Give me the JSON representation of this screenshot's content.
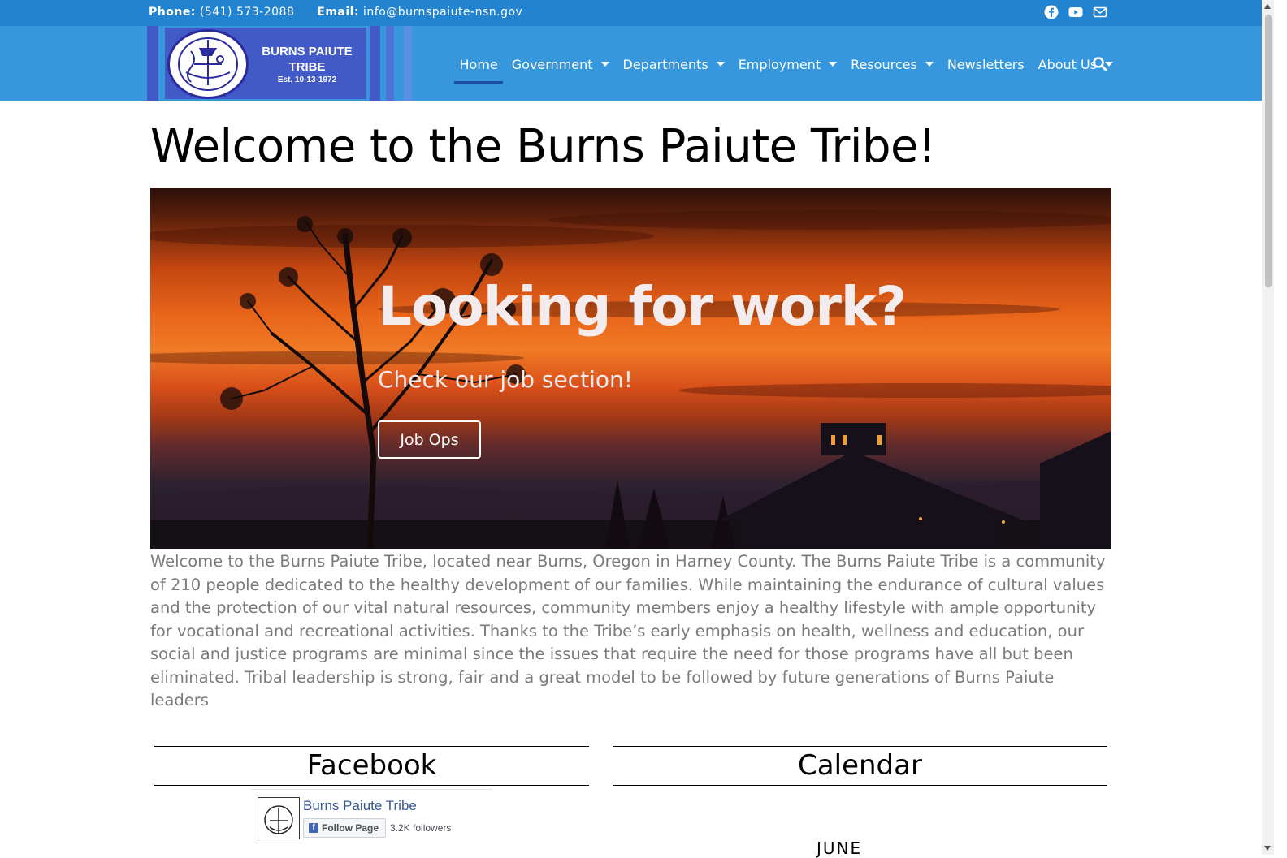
{
  "topbar": {
    "phone_label": "Phone:",
    "phone": "(541) 573-2088",
    "email_label": "Email:",
    "email": "info@burnspaiute-nsn.gov",
    "social_icons": [
      "facebook-icon",
      "youtube-icon",
      "mail-icon"
    ]
  },
  "logo": {
    "title_line1": "BURNS PAIUTE",
    "title_line2": "TRIBE",
    "est": "Est. 10-13-1972"
  },
  "nav": {
    "items": [
      {
        "label": "Home",
        "active": true,
        "dropdown": false
      },
      {
        "label": "Government",
        "dropdown": true
      },
      {
        "label": "Departments",
        "dropdown": true
      },
      {
        "label": "Employment",
        "dropdown": true
      },
      {
        "label": "Resources",
        "dropdown": true
      },
      {
        "label": "Newsletters",
        "dropdown": false
      },
      {
        "label": "About Us",
        "dropdown": true
      }
    ]
  },
  "main": {
    "title": "Welcome to the Burns Paiute Tribe!",
    "hero": {
      "title": "Looking for work?",
      "subtitle": "Check our job section!",
      "button": "Job Ops"
    },
    "intro": "Welcome to the Burns Paiute Tribe, located near Burns, Oregon in Harney County. The Burns Paiute Tribe is a community of 210 people dedicated to the healthy development of our families. While maintaining the endurance of cultural values and the protection of our vital natural resources, community members enjoy a healthy lifestyle with ample opportunity for vocational and recreational activities. Thanks to the Tribe’s early emphasis on health, wellness and education, our social and justice programs are minimal since the issues that require the need for those programs have all but been eliminated. Tribal leadership is strong, fair and a great model to be followed by future generations of Burns Paiute leaders"
  },
  "facebook": {
    "heading": "Facebook",
    "page_name": "Burns Paiute Tribe",
    "follow": "Follow Page",
    "followers": "3.2K followers"
  },
  "calendar": {
    "heading": "Calendar",
    "month": "JUNE"
  },
  "colors": {
    "topbar": "#2283d1",
    "navbar": "#3797dd",
    "logo_card": "#4259c8",
    "active_underline": "#1b4fa5"
  }
}
